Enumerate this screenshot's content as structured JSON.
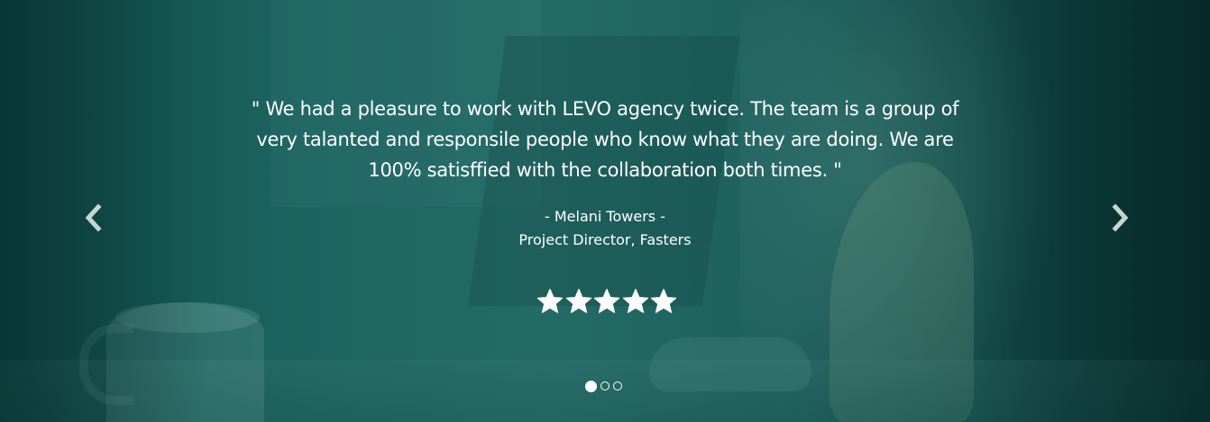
{
  "testimonial": {
    "quote": "\" We had a pleasure to work with LEVO agency twice. The team is a group of very talanted and responsile people who know what they are doing. We are 100% satisffied with the collaboration both times. \"",
    "author_name": "- Melani Towers -",
    "author_title": "Project Director, Fasters",
    "rating": 5,
    "rating_max": 5
  },
  "navigation": {
    "prev_icon": "chevron-left-icon",
    "next_icon": "chevron-right-icon",
    "slide_count": 3,
    "active_slide": 1
  },
  "colors": {
    "overlay": "#1d6461",
    "text": "#ffffff",
    "star": "#ffffff",
    "arrow": "#c5d6d4"
  }
}
